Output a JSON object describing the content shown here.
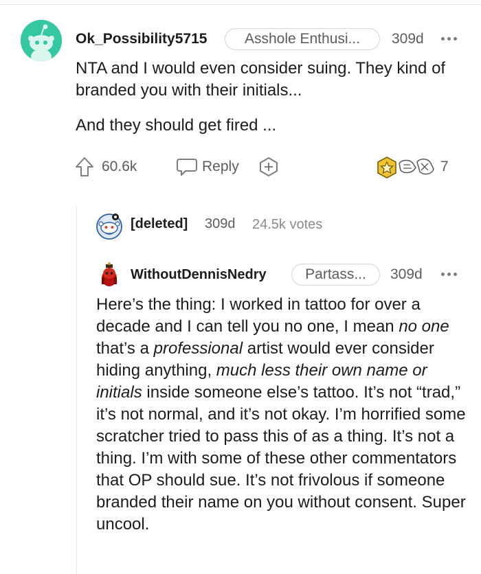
{
  "comment": {
    "username": "Ok_Possibility5715",
    "flair": "Asshole Enthusi...",
    "age": "309d",
    "paragraphs": [
      "NTA and I would even consider suing. They kind of branded you with their initials...",
      "And they should get fired ..."
    ],
    "score": "60.6k",
    "reply_label": "Reply",
    "award_count": "7"
  },
  "deleted": {
    "name": "[deleted]",
    "age": "309d",
    "votes": "24.5k votes"
  },
  "reply": {
    "username": "WithoutDennisNedry",
    "flair": "Partass...",
    "age": "309d",
    "body_segments": [
      {
        "t": "Here’s the thing: I worked in tattoo for over a decade and I can tell you no one, I mean ",
        "i": false
      },
      {
        "t": "no one",
        "i": true
      },
      {
        "t": " that’s a ",
        "i": false
      },
      {
        "t": "professional",
        "i": true
      },
      {
        "t": " artist would ever consider hiding anything, ",
        "i": false
      },
      {
        "t": "much less their own name or initials",
        "i": true
      },
      {
        "t": " inside someone else’s tattoo. It’s not “trad,” it’s not normal, and it’s not okay. I’m horrified some scratcher tried to pass this of as a thing. It’s not a thing. I’m with some of these other commentators that OP should sue. It’s not frivolous if someone branded their name on you without consent. Super uncool.",
        "i": false
      }
    ]
  },
  "colors": {
    "avatar_teal": "#33c7a2",
    "meta_gray": "#5c5c5c",
    "award_gold": "#f2c12e"
  }
}
